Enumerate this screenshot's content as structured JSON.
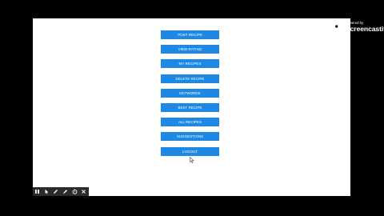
{
  "menu": {
    "buttons": [
      {
        "id": "post-recipe",
        "label": "POST RECIPE"
      },
      {
        "id": "view-rating",
        "label": "VIEW RATING"
      },
      {
        "id": "my-recipes",
        "label": "MY RECIPES"
      },
      {
        "id": "delete-recipe",
        "label": "DELETE RECIPE"
      },
      {
        "id": "keywords",
        "label": "KEYWORDS"
      },
      {
        "id": "best-recipe",
        "label": "BEST RECIPE"
      },
      {
        "id": "all-recipes",
        "label": "ALL RECIPES"
      },
      {
        "id": "suggestions",
        "label": "SUGGESTIONS"
      },
      {
        "id": "logout",
        "label": "LOGOUT"
      }
    ],
    "button_color": "#1e88e5",
    "text_color": "#ffffff"
  },
  "watermark": {
    "small_text": "powered by",
    "brand_text": "Screencastify",
    "logo_icon": "screencastify-logo-icon"
  },
  "drawing_toolbar": {
    "tools": [
      {
        "name": "pause-icon"
      },
      {
        "name": "cursor-icon"
      },
      {
        "name": "pen-icon"
      },
      {
        "name": "highlighter-icon"
      },
      {
        "name": "timer-icon"
      },
      {
        "name": "close-icon"
      }
    ]
  },
  "colors": {
    "background": "#000000",
    "page": "#ffffff",
    "toolbar": "#2b2b2b"
  }
}
